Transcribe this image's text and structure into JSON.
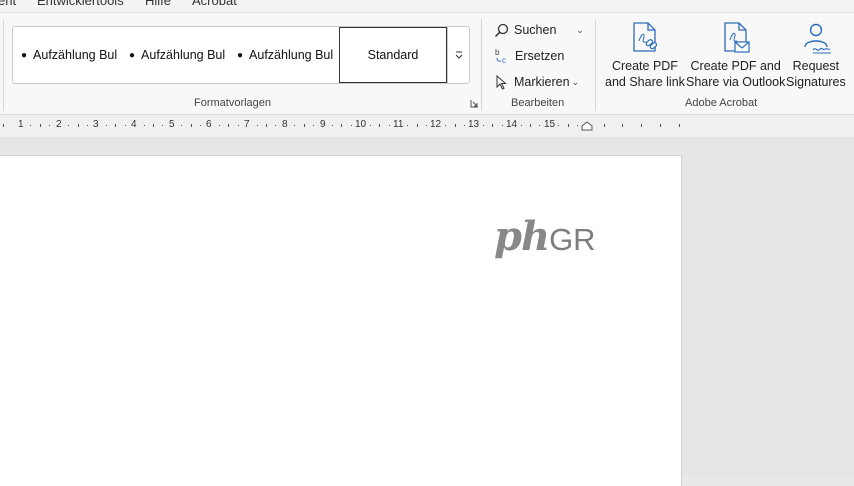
{
  "tabs": [
    {
      "label": "ent"
    },
    {
      "label": "Entwicklertools"
    },
    {
      "label": "Hilfe"
    },
    {
      "label": "Acrobat"
    }
  ],
  "styles_group": {
    "label": "Formatvorlagen",
    "items": [
      {
        "label": "Aufzählung Bul"
      },
      {
        "label": "Aufzählung Bul"
      },
      {
        "label": "Aufzählung Bul"
      }
    ],
    "selected": "Standard"
  },
  "edit_group": {
    "label": "Bearbeiten",
    "search": "Suchen",
    "replace": "Ersetzen",
    "select": "Markieren"
  },
  "acrobat_group": {
    "label": "Adobe Acrobat",
    "create_share_link": [
      "Create PDF",
      "and Share link"
    ],
    "create_share_outlook": [
      "Create PDF and",
      "Share via Outlook"
    ],
    "request_signatures": [
      "Request",
      "Signatures"
    ]
  },
  "ruler": {
    "numbers": [
      "1",
      "2",
      "3",
      "4",
      "5",
      "6",
      "7",
      "8",
      "9",
      "10",
      "11",
      "12",
      "13",
      "14",
      "15"
    ]
  },
  "document": {
    "logo_main": "ph",
    "logo_suffix": "GR"
  },
  "colors": {
    "acrobat_blue": "#2b6cb8",
    "ribbon_bg": "#f8f8f8"
  }
}
